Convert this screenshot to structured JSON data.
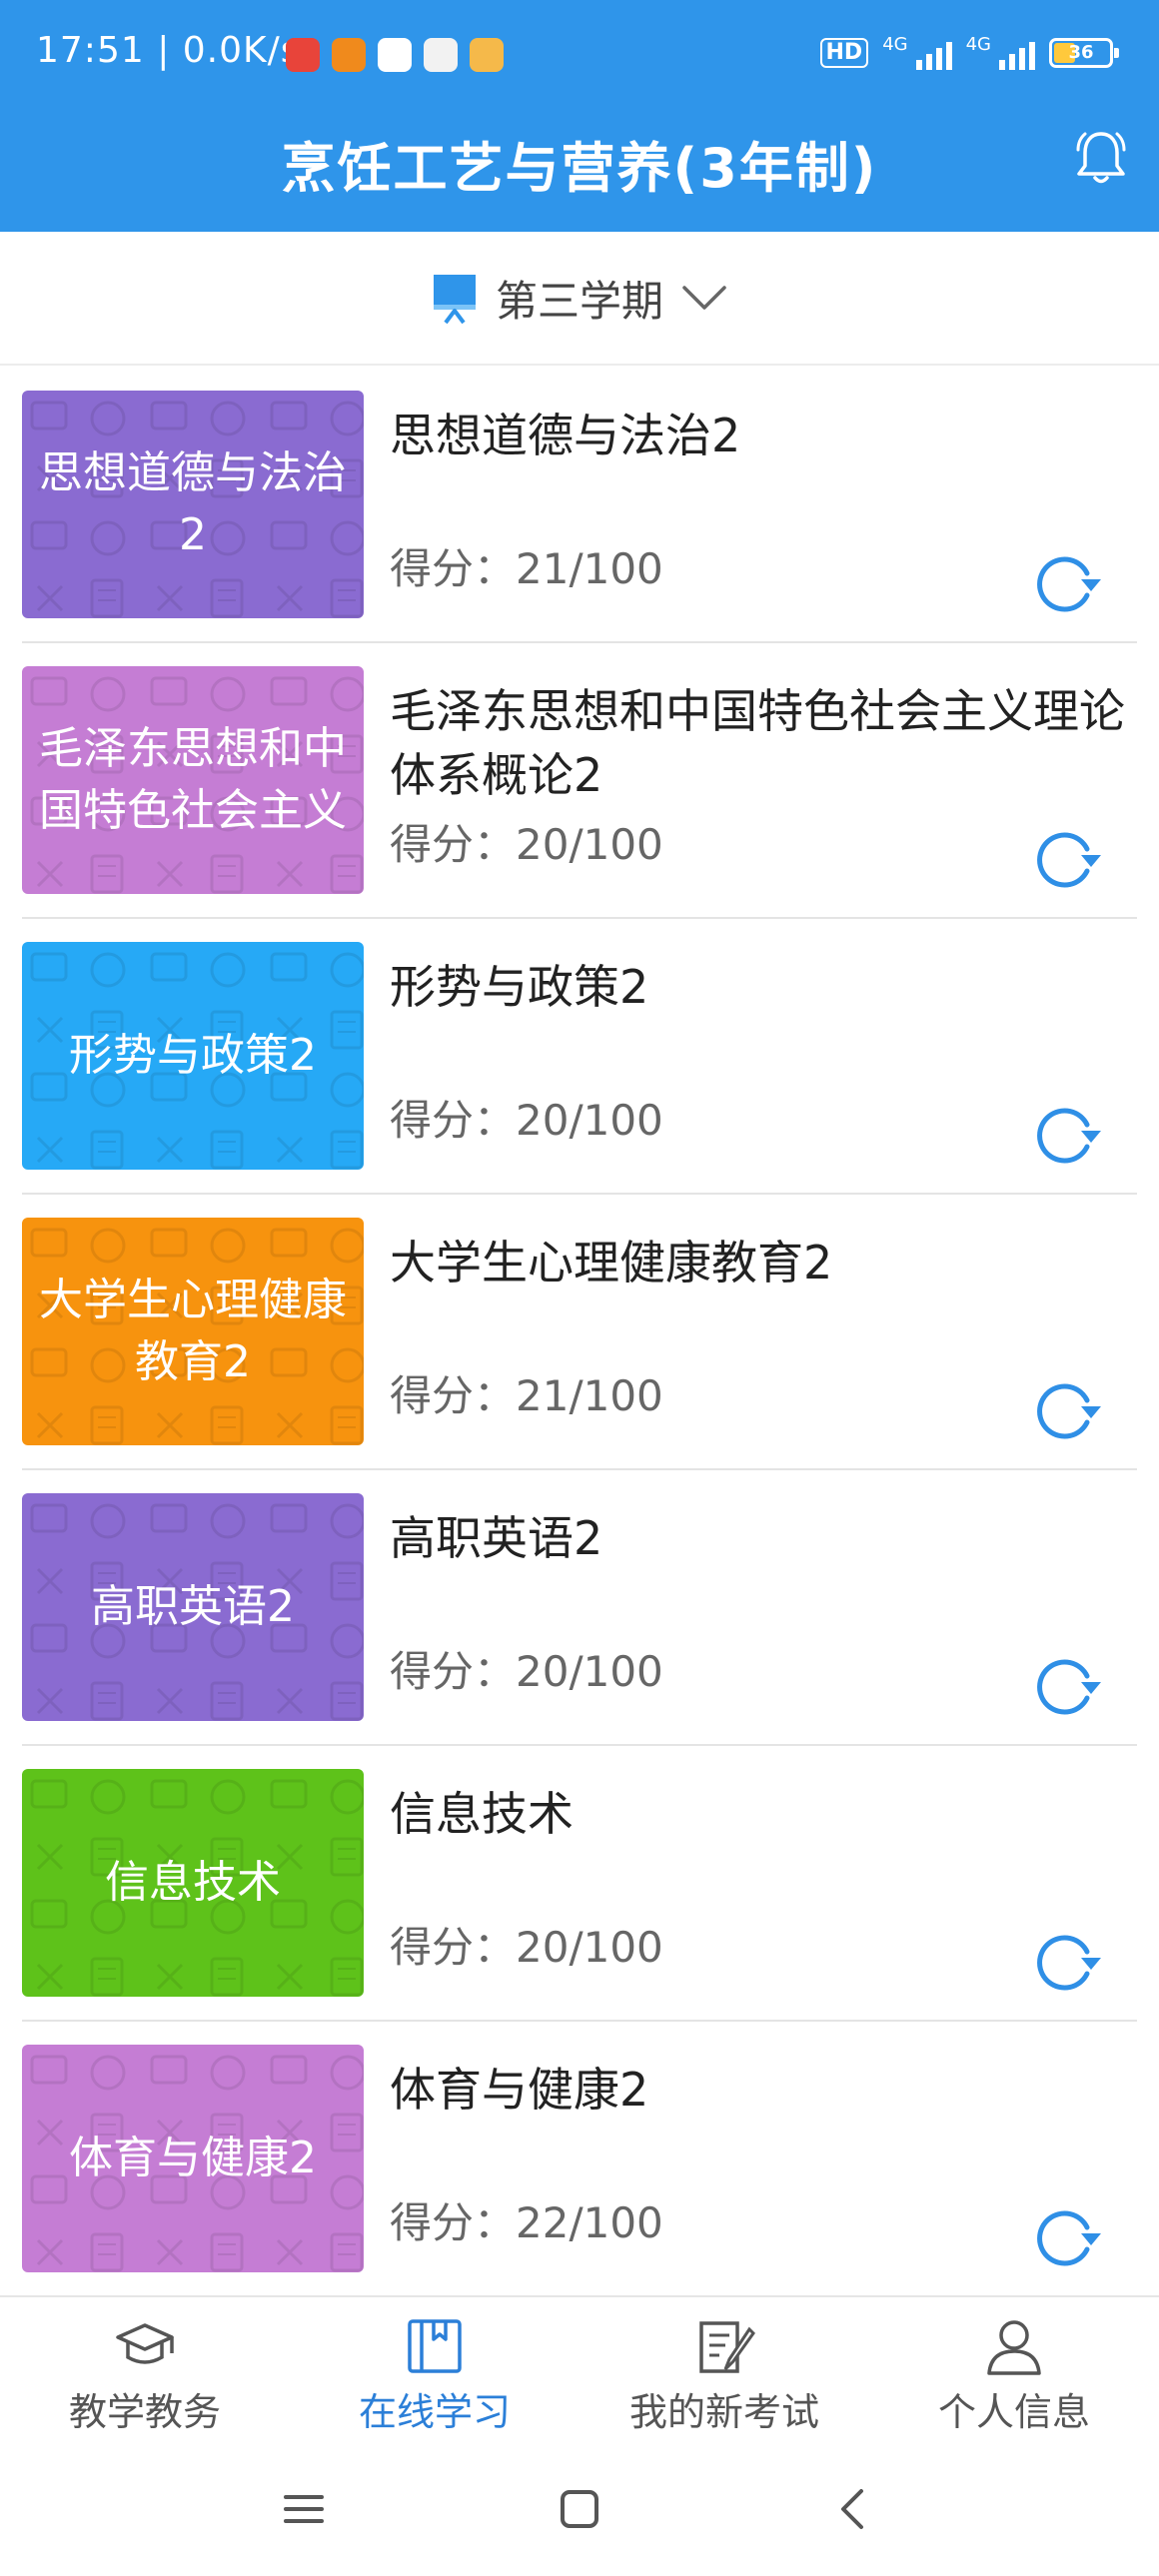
{
  "status_bar": {
    "time": "17:51 | 0.0K/s",
    "hd": "HD",
    "net1": "4G",
    "net2": "4G",
    "battery": "36"
  },
  "header": {
    "title": "烹饪工艺与营养(3年制)"
  },
  "semester": {
    "label": "第三学期"
  },
  "courses": [
    {
      "thumb_text": "思想道德与法治2",
      "title": "思想道德与法治2",
      "score": "得分：21/100",
      "color": "#8a6bd1"
    },
    {
      "thumb_text": "毛泽东思想和中国特色社会主义",
      "title": "毛泽东思想和中国特色社会主义理论体系概论2",
      "score": "得分：20/100",
      "color": "#c57dd4"
    },
    {
      "thumb_text": "形势与政策2",
      "title": "形势与政策2",
      "score": "得分：20/100",
      "color": "#26a9f6"
    },
    {
      "thumb_text": "大学生心理健康教育2",
      "title": "大学生心理健康教育2",
      "score": "得分：21/100",
      "color": "#f7930e"
    },
    {
      "thumb_text": "高职英语2",
      "title": "高职英语2",
      "score": "得分：20/100",
      "color": "#8a6bd1"
    },
    {
      "thumb_text": "信息技术",
      "title": "信息技术",
      "score": "得分：20/100",
      "color": "#5ec21a"
    },
    {
      "thumb_text": "体育与健康2",
      "title": "体育与健康2",
      "score": "得分：22/100",
      "color": "#c57dd4"
    }
  ],
  "bottom_nav": [
    {
      "label": "教学教务",
      "icon": "graduation-cap-icon",
      "active": false
    },
    {
      "label": "在线学习",
      "icon": "book-icon",
      "active": true
    },
    {
      "label": "我的新考试",
      "icon": "exam-paper-icon",
      "active": false
    },
    {
      "label": "个人信息",
      "icon": "person-icon",
      "active": false
    }
  ],
  "colors": {
    "brand": "#2f95ea",
    "active_nav": "#2b7fd8",
    "refresh": "#2f8fe6"
  }
}
